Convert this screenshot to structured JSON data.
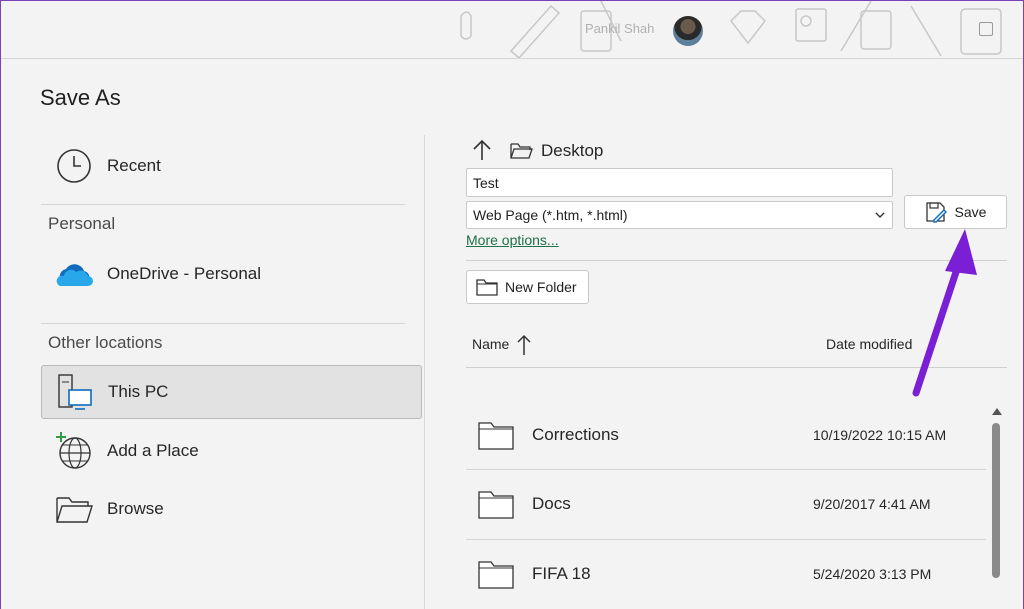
{
  "titlebar": {
    "user_name": "Pankil Shah"
  },
  "page_title": "Save As",
  "nav": {
    "recent": "Recent",
    "personal_header": "Personal",
    "onedrive": "OneDrive - Personal",
    "other_header": "Other locations",
    "this_pc": "This PC",
    "add_place": "Add a Place",
    "browse": "Browse"
  },
  "location": {
    "current_folder": "Desktop"
  },
  "save_form": {
    "filename_value": "Test",
    "file_type": "Web Page (*.htm, *.html)",
    "more_options": "More options...",
    "save_label": "Save",
    "new_folder_label": "New Folder"
  },
  "file_list": {
    "col_name": "Name",
    "col_date": "Date modified",
    "rows": [
      {
        "name": "Corrections",
        "date": "10/19/2022 10:15 AM"
      },
      {
        "name": "Docs",
        "date": "9/20/2017 4:41 AM"
      },
      {
        "name": "FIFA 18",
        "date": "5/24/2020 3:13 PM"
      }
    ]
  },
  "colors": {
    "link_green": "#1e7145",
    "annotation_arrow": "#7a1fd6",
    "selected_bg": "#e2e2e2"
  }
}
